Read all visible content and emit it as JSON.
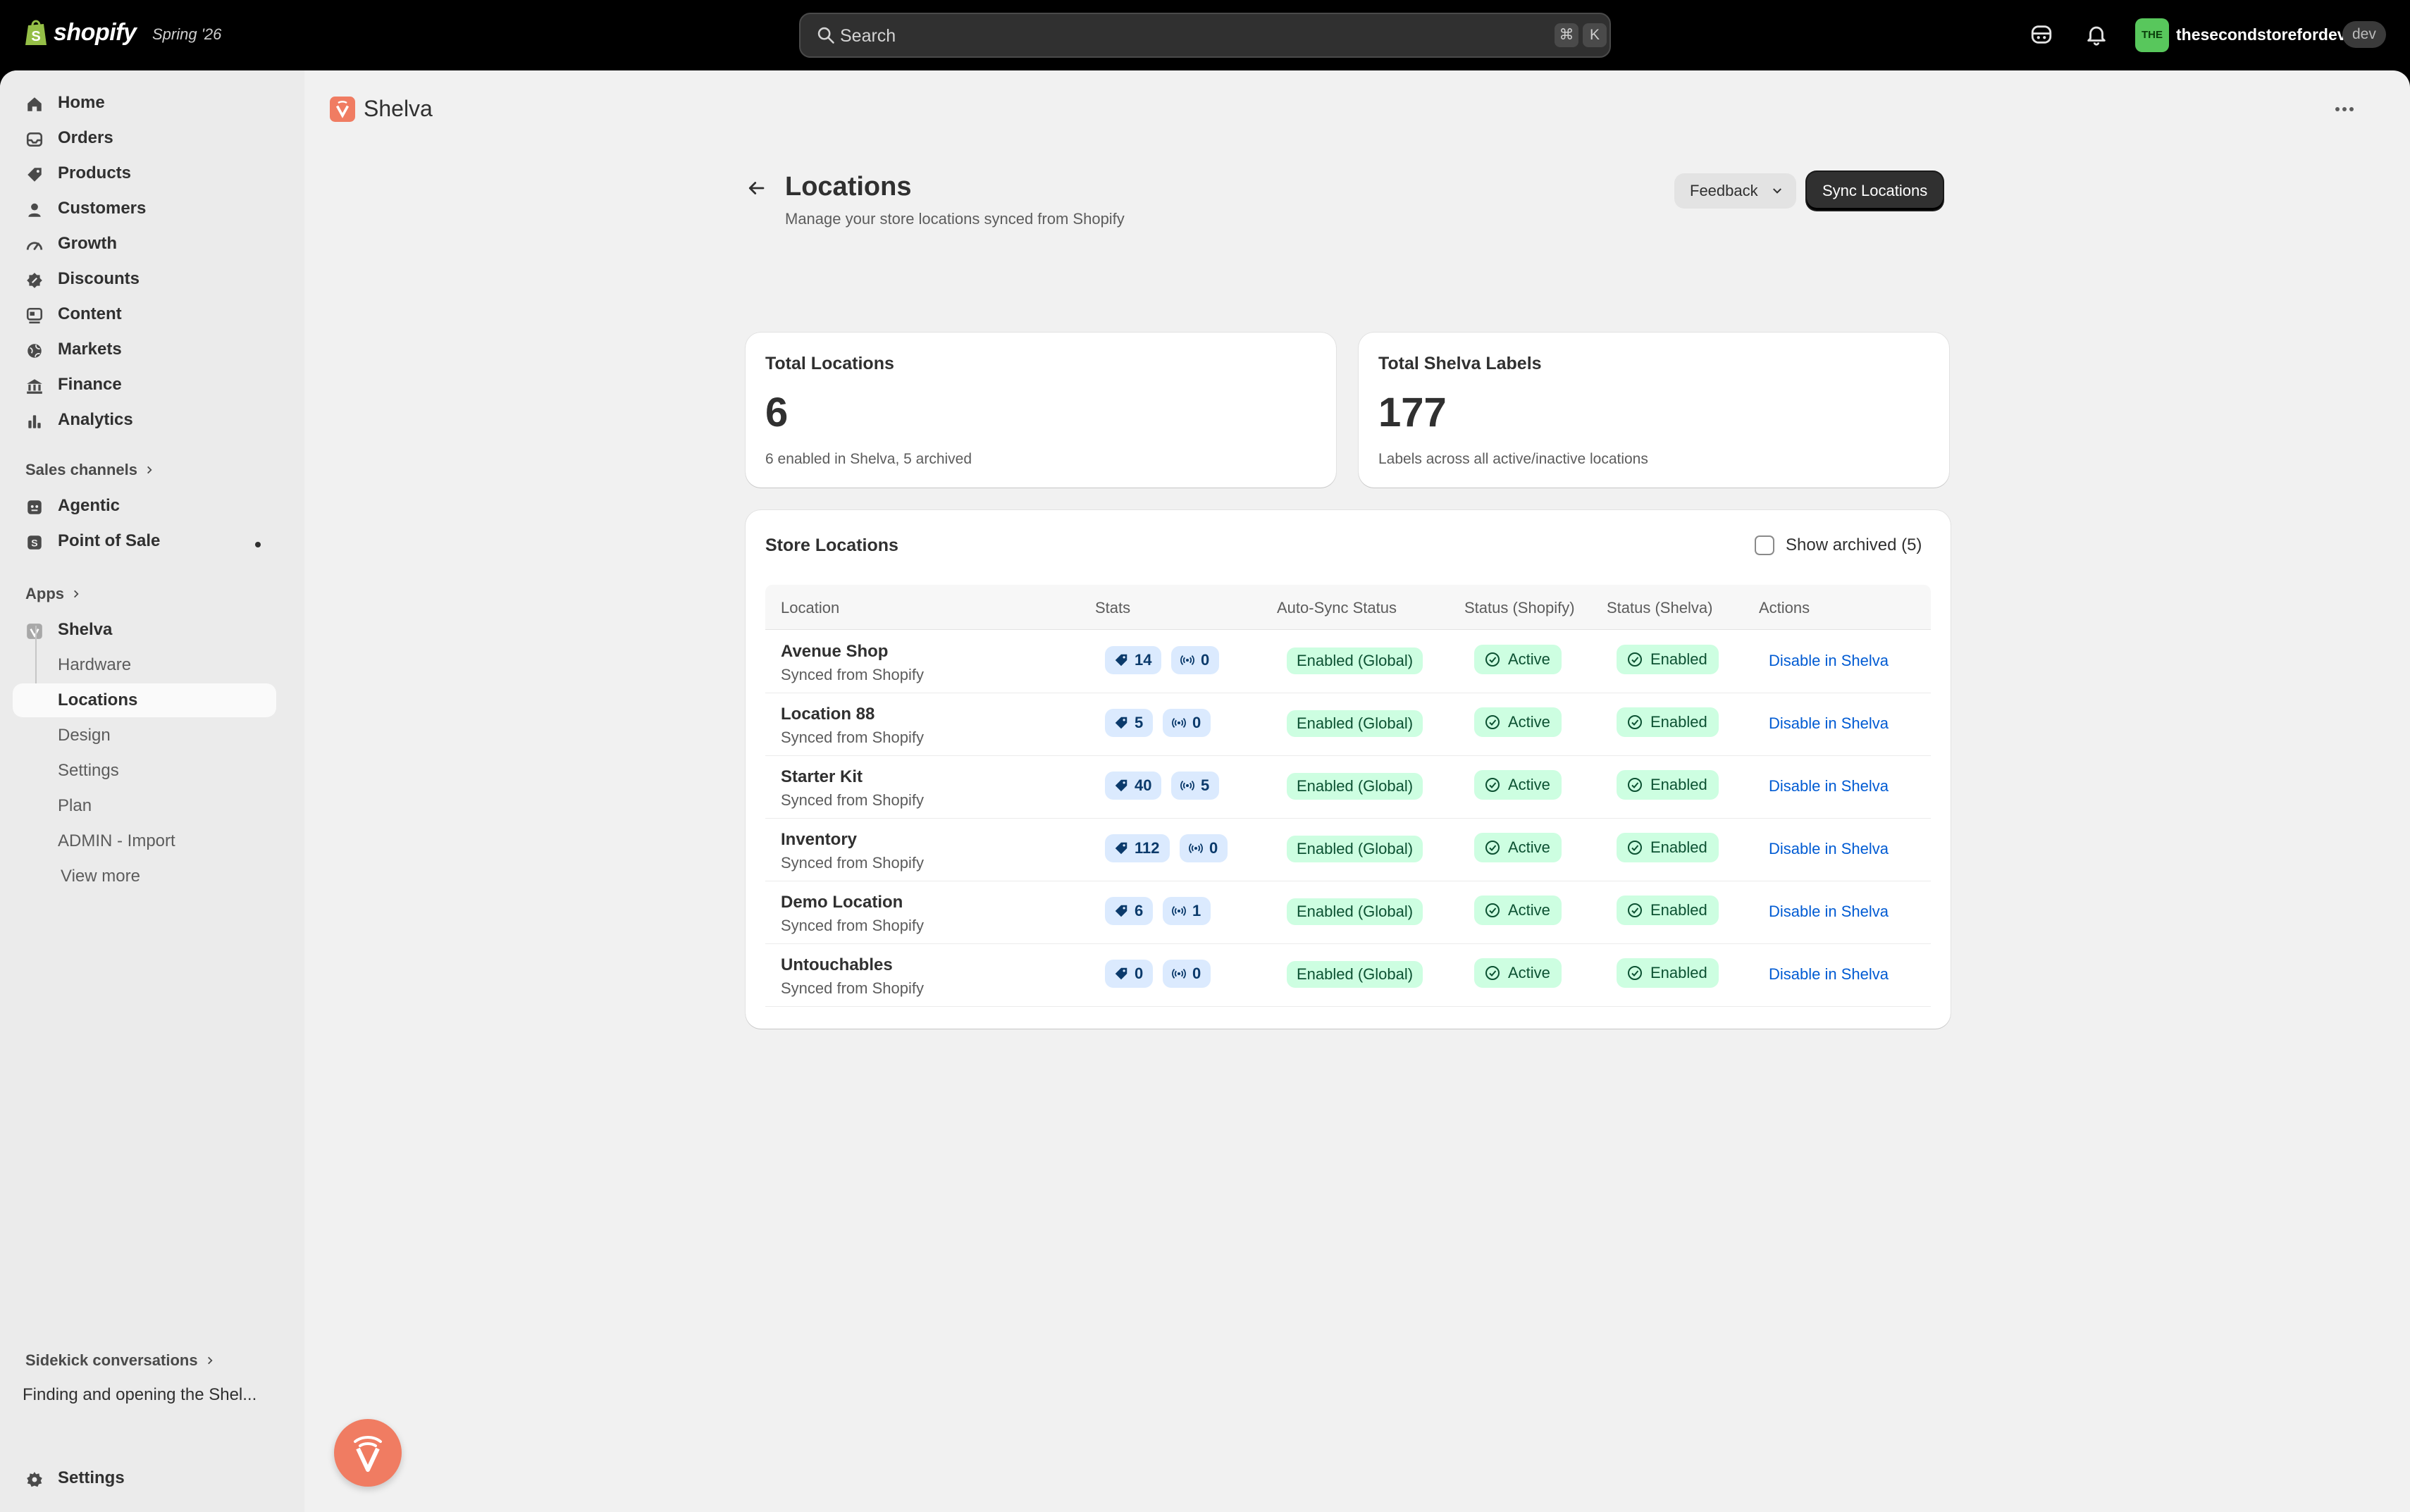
{
  "topbar": {
    "brand": "shopify",
    "release": "Spring '26",
    "search_placeholder": "Search",
    "shortcut_cmd": "⌘",
    "shortcut_key": "K",
    "store_initials": "THE",
    "store_name": "thesecondstorefordev",
    "store_badge": "dev"
  },
  "sidebar": {
    "items": [
      {
        "label": "Home",
        "icon": "home-icon"
      },
      {
        "label": "Orders",
        "icon": "inbox-icon"
      },
      {
        "label": "Products",
        "icon": "tag-icon"
      },
      {
        "label": "Customers",
        "icon": "person-icon"
      },
      {
        "label": "Growth",
        "icon": "gauge-icon"
      },
      {
        "label": "Discounts",
        "icon": "discount-icon"
      },
      {
        "label": "Content",
        "icon": "content-icon"
      },
      {
        "label": "Markets",
        "icon": "globe-icon"
      },
      {
        "label": "Finance",
        "icon": "bank-icon"
      },
      {
        "label": "Analytics",
        "icon": "bar-chart-icon"
      }
    ],
    "sales_channels_header": "Sales channels",
    "channels": [
      {
        "label": "Agentic",
        "icon": "agentic-icon"
      },
      {
        "label": "Point of Sale",
        "icon": "pos-icon"
      }
    ],
    "apps_header": "Apps",
    "app_name": "Shelva",
    "app_subitems": [
      "Hardware",
      "Locations",
      "Design",
      "Settings",
      "Plan",
      "ADMIN - Import"
    ],
    "active_subitem": "Locations",
    "view_more": "View more",
    "sidekick_header": "Sidekick conversations",
    "conversation": "Finding and opening the Shel...",
    "settings": "Settings"
  },
  "app_header": {
    "title": "Shelva"
  },
  "page": {
    "title": "Locations",
    "subtitle": "Manage your store locations synced from Shopify",
    "feedback_label": "Feedback",
    "sync_label": "Sync Locations"
  },
  "stats": {
    "total_locations": {
      "title": "Total Locations",
      "value": "6",
      "note": "6 enabled in Shelva, 5 archived"
    },
    "total_labels": {
      "title": "Total Shelva Labels",
      "value": "177",
      "note": "Labels across all active/inactive locations"
    }
  },
  "locations_table": {
    "title": "Store Locations",
    "show_archived_label": "Show archived (5)",
    "show_archived_checked": false,
    "columns": [
      "Location",
      "Stats",
      "Auto-Sync Status",
      "Status (Shopify)",
      "Status (Shelva)",
      "Actions"
    ],
    "rows": [
      {
        "name": "Avenue Shop",
        "source": "Synced from Shopify",
        "labels": "14",
        "devices": "0",
        "auto_sync": "Enabled (Global)",
        "shopify_status": "Active",
        "shelva_status": "Enabled",
        "action": "Disable in Shelva"
      },
      {
        "name": "Location 88",
        "source": "Synced from Shopify",
        "labels": "5",
        "devices": "0",
        "auto_sync": "Enabled (Global)",
        "shopify_status": "Active",
        "shelva_status": "Enabled",
        "action": "Disable in Shelva"
      },
      {
        "name": "Starter Kit",
        "source": "Synced from Shopify",
        "labels": "40",
        "devices": "5",
        "auto_sync": "Enabled (Global)",
        "shopify_status": "Active",
        "shelva_status": "Enabled",
        "action": "Disable in Shelva"
      },
      {
        "name": "Inventory",
        "source": "Synced from Shopify",
        "labels": "112",
        "devices": "0",
        "auto_sync": "Enabled (Global)",
        "shopify_status": "Active",
        "shelva_status": "Enabled",
        "action": "Disable in Shelva"
      },
      {
        "name": "Demo Location",
        "source": "Synced from Shopify",
        "labels": "6",
        "devices": "1",
        "auto_sync": "Enabled (Global)",
        "shopify_status": "Active",
        "shelva_status": "Enabled",
        "action": "Disable in Shelva"
      },
      {
        "name": "Untouchables",
        "source": "Synced from Shopify",
        "labels": "0",
        "devices": "0",
        "auto_sync": "Enabled (Global)",
        "shopify_status": "Active",
        "shelva_status": "Enabled",
        "action": "Disable in Shelva"
      }
    ]
  },
  "colors": {
    "accent_link": "#005bd3",
    "success_bg": "#cdfee1",
    "success_text": "#0c5132",
    "stat_pill_bg": "#dbeafe",
    "brand_app": "#f07c62"
  }
}
